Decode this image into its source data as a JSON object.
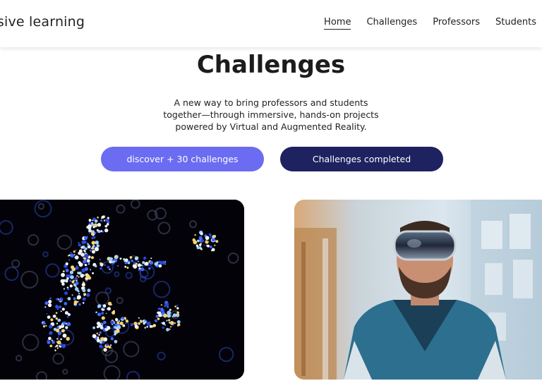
{
  "header": {
    "brand": "ersive learning",
    "nav": [
      {
        "label": "Home",
        "active": true
      },
      {
        "label": "Challenges",
        "active": false
      },
      {
        "label": "Professors",
        "active": false
      },
      {
        "label": "Students",
        "active": false
      }
    ]
  },
  "hero": {
    "title": "Challenges",
    "subtitle": "A new way to bring professors and students together—through immersive, hands-on projects powered by Virtual and Augmented Reality.",
    "buttons": {
      "discover": "discover + 30 challenges",
      "completed": "Challenges completed"
    }
  },
  "colors": {
    "discover_button": "#6b6cf2",
    "completed_button": "#1e2260"
  }
}
